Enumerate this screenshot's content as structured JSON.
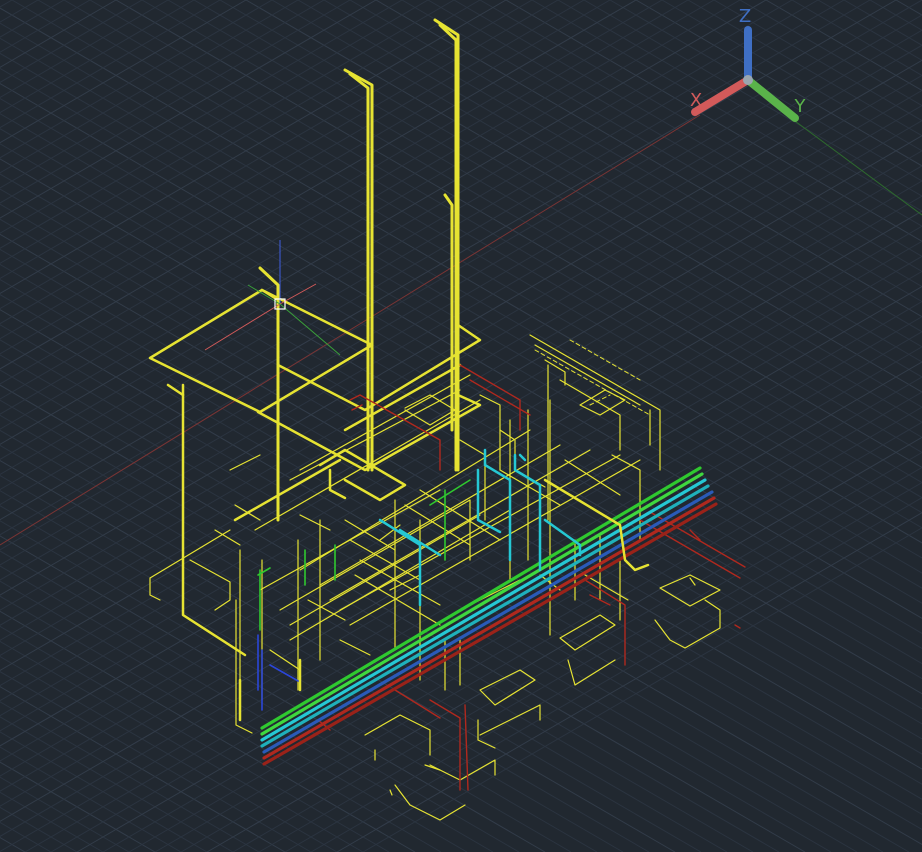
{
  "viewport": {
    "background": "#212830",
    "grid_color": "#2b3440",
    "grid_major_color": "#323c49"
  },
  "view_cube": {
    "z_label": "Z",
    "x_label": "X",
    "y_label": "Y",
    "z_color": "#3f6fc4",
    "x_color": "#d25a5a",
    "y_color": "#5ab34a"
  },
  "ucs_icon": {
    "name": "ucs-crosshair"
  },
  "colors": {
    "pipe_yellow": "#e6e332",
    "pipe_green": "#2fc92f",
    "pipe_cyan": "#25c8d4",
    "pipe_red": "#b0281e",
    "pipe_blue": "#2b46d8",
    "axis_line_red": "#7a3434",
    "axis_line_green": "#2d6a2d"
  }
}
